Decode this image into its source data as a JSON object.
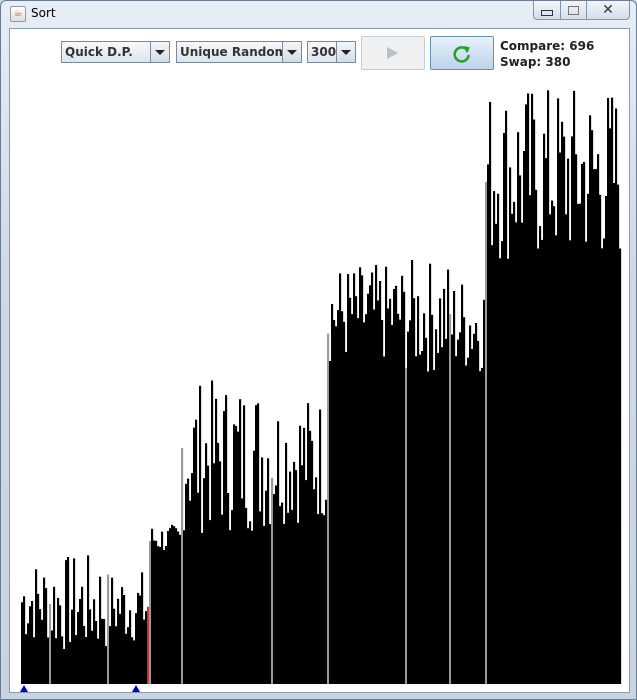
{
  "window": {
    "title": "Sort"
  },
  "controls": {
    "algorithm": "Quick D.P.",
    "distribution": "Unique Random",
    "size": "300"
  },
  "stats": {
    "compare_label": "Compare:",
    "compare_value": "696",
    "swap_label": "Swap:",
    "swap_value": "380"
  },
  "colors": {
    "bar": "#000000",
    "highlight_bar": "#cc3333",
    "divider": "#9a9a9a",
    "marker": "#0000cc"
  },
  "icons": {
    "app": "java-cup-icon",
    "play": "play-icon",
    "refresh": "refresh-icon"
  },
  "array": {
    "count": 300
  }
}
